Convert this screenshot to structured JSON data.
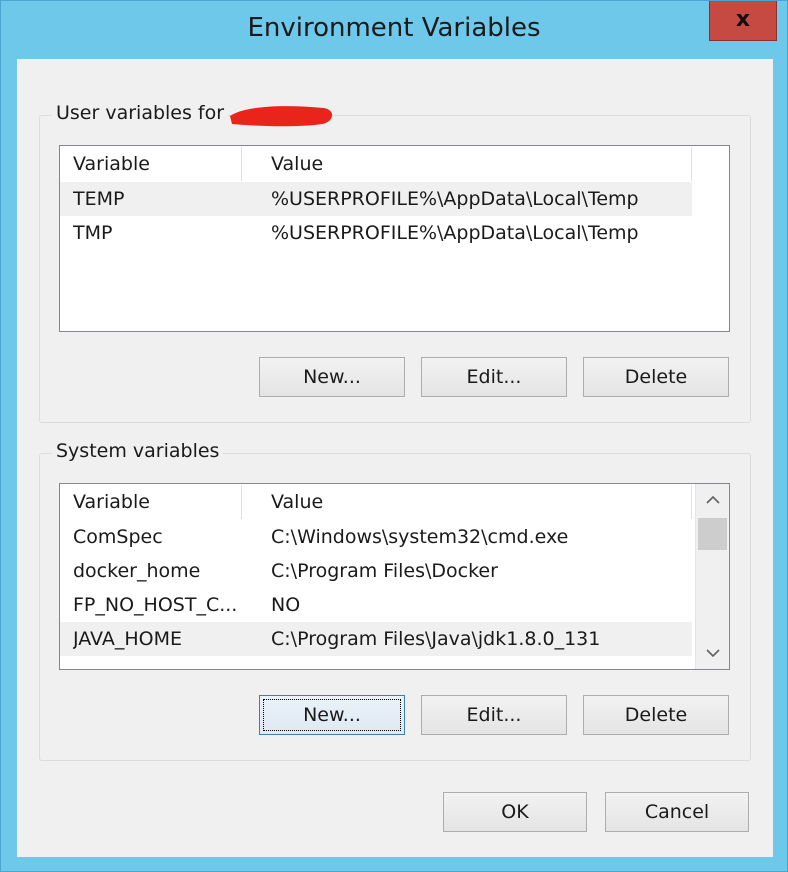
{
  "window": {
    "title": "Environment Variables",
    "close_label": "x"
  },
  "user_vars": {
    "group_label": "User variables for",
    "columns": [
      "Variable",
      "Value"
    ],
    "rows": [
      {
        "variable": "TEMP",
        "value": "%USERPROFILE%\\AppData\\Local\\Temp"
      },
      {
        "variable": "TMP",
        "value": "%USERPROFILE%\\AppData\\Local\\Temp"
      }
    ],
    "buttons": {
      "new": "New...",
      "edit": "Edit...",
      "delete": "Delete"
    }
  },
  "system_vars": {
    "group_label": "System variables",
    "columns": [
      "Variable",
      "Value"
    ],
    "rows": [
      {
        "variable": "ComSpec",
        "value": "C:\\Windows\\system32\\cmd.exe"
      },
      {
        "variable": "docker_home",
        "value": "C:\\Program Files\\Docker"
      },
      {
        "variable": "FP_NO_HOST_C...",
        "value": "NO"
      },
      {
        "variable": "JAVA_HOME",
        "value": "C:\\Program Files\\Java\\jdk1.8.0_131"
      }
    ],
    "buttons": {
      "new": "New...",
      "edit": "Edit...",
      "delete": "Delete"
    }
  },
  "footer": {
    "ok": "OK",
    "cancel": "Cancel"
  },
  "colors": {
    "title_bar": "#6ec8ea",
    "close_button": "#c74a42",
    "redaction": "#e8241b",
    "selected_row": "#f0f0f0"
  },
  "icons": {
    "scroll_up": "chevron-up-icon",
    "scroll_down": "chevron-down-icon"
  }
}
